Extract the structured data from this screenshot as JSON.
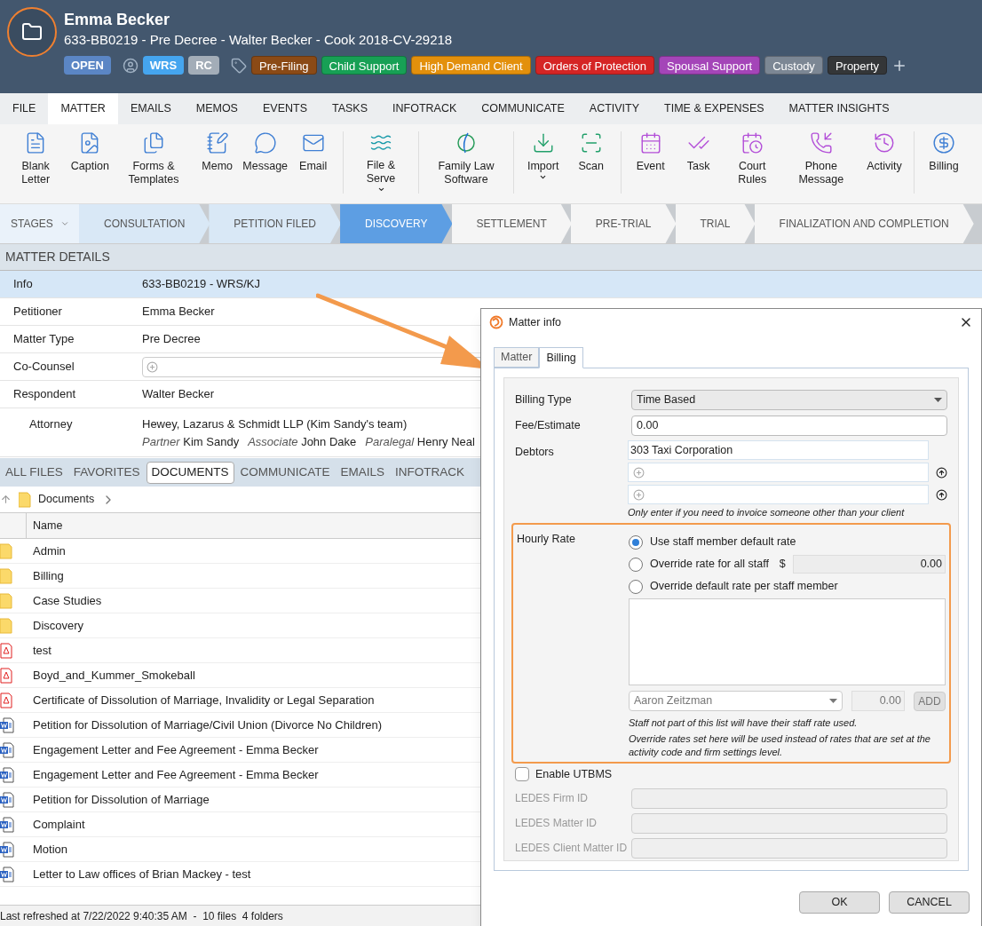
{
  "header": {
    "name": "Emma Becker",
    "subtitle": "633-BB0219 - Pre Decree - Walter Becker - Cook 2018-CV-29218",
    "status": "OPEN",
    "staff": [
      {
        "label": "WRS",
        "color": "#45a5ef"
      },
      {
        "label": "RC",
        "color": "#a3adb8"
      }
    ],
    "tags": [
      {
        "label": "Pre-Filing",
        "color": "#8b4a16"
      },
      {
        "label": "Child Support",
        "color": "#17a055"
      },
      {
        "label": "High Demand Client",
        "color": "#e3900c"
      },
      {
        "label": "Orders of Protection",
        "color": "#d52525"
      },
      {
        "label": "Spousal Support",
        "color": "#a445b8"
      },
      {
        "label": "Custody",
        "color": "#7c8794"
      },
      {
        "label": "Property",
        "color": "#343638"
      }
    ]
  },
  "ribbon_tabs": [
    {
      "label": "FILE",
      "selected": false
    },
    {
      "label": "MATTER",
      "selected": true
    },
    {
      "label": "EMAILS",
      "selected": false
    },
    {
      "label": "MEMOS",
      "selected": false
    },
    {
      "label": "EVENTS",
      "selected": false
    },
    {
      "label": "TASKS",
      "selected": false
    },
    {
      "label": "INFOTRACK",
      "selected": false
    },
    {
      "label": "COMMUNICATE",
      "selected": false
    },
    {
      "label": "ACTIVITY",
      "selected": false
    },
    {
      "label": "TIME & EXPENSES",
      "selected": false
    },
    {
      "label": "MATTER INSIGHTS",
      "selected": false
    }
  ],
  "toolbar_groups": [
    {
      "items": [
        {
          "label": "Blank Letter",
          "dropdown": false
        },
        {
          "label": "Caption",
          "dropdown": false
        },
        {
          "label": "Forms & Templates",
          "dropdown": false
        },
        {
          "label": "Memo",
          "dropdown": false
        },
        {
          "label": "Message",
          "dropdown": false
        },
        {
          "label": "Email",
          "dropdown": false
        }
      ]
    },
    {
      "items": [
        {
          "label": "File & Serve",
          "dropdown": true
        }
      ]
    },
    {
      "items": [
        {
          "label": "Family Law Software",
          "dropdown": false
        }
      ]
    },
    {
      "items": [
        {
          "label": "Import",
          "dropdown": true
        },
        {
          "label": "Scan",
          "dropdown": false
        }
      ]
    },
    {
      "items": [
        {
          "label": "Event",
          "dropdown": false
        },
        {
          "label": "Task",
          "dropdown": false
        },
        {
          "label": "Court Rules",
          "dropdown": false
        },
        {
          "label": "Phone Message",
          "dropdown": false
        },
        {
          "label": "Activity",
          "dropdown": false
        }
      ]
    },
    {
      "items": [
        {
          "label": "Billing",
          "dropdown": false
        }
      ]
    }
  ],
  "stages": {
    "label": "STAGES",
    "items": [
      {
        "label": "CONSULTATION",
        "completed": true,
        "selected": false
      },
      {
        "label": "PETITION FILED",
        "completed": true,
        "selected": false
      },
      {
        "label": "DISCOVERY",
        "completed": false,
        "selected": true
      },
      {
        "label": "SETTLEMENT",
        "completed": false,
        "selected": false
      },
      {
        "label": "PRE-TRIAL",
        "completed": false,
        "selected": false
      },
      {
        "label": "TRIAL",
        "completed": false,
        "selected": false
      },
      {
        "label": "FINALIZATION AND COMPLETION",
        "completed": false,
        "selected": false
      }
    ]
  },
  "matter_details": {
    "title": "MATTER DETAILS",
    "rows": [
      {
        "label": "Info",
        "value": "633-BB0219 - WRS/KJ",
        "selected": true
      },
      {
        "label": "Petitioner",
        "value": "Emma Becker",
        "selected": false
      },
      {
        "label": "Matter Type",
        "value": "Pre Decree",
        "selected": false
      },
      {
        "label": "Co-Counsel",
        "kind": "field",
        "selected": false
      },
      {
        "label": "Respondent",
        "value": "Walter Becker",
        "selected": false,
        "children": [
          {
            "label": "Attorney",
            "value": "Hewey, Lazarus & Schmidt LLP (Kim Sandy's team)",
            "team": [
              {
                "role": "Partner",
                "name": "Kim Sandy"
              },
              {
                "role": "Associate",
                "name": "John Dake"
              },
              {
                "role": "Paralegal",
                "name": "Henry Neal"
              }
            ]
          }
        ]
      }
    ]
  },
  "file_tabs": [
    {
      "label": "ALL FILES",
      "selected": false
    },
    {
      "label": "FAVORITES",
      "selected": false
    },
    {
      "label": "DOCUMENTS",
      "selected": true
    },
    {
      "label": "COMMUNICATE",
      "selected": false
    },
    {
      "label": "EMAILS",
      "selected": false
    },
    {
      "label": "INFOTRACK",
      "selected": false
    }
  ],
  "breadcrumb": "Documents",
  "files_table": {
    "columns": [
      "Name"
    ],
    "rows": [
      {
        "name": "Admin",
        "kind": "folder"
      },
      {
        "name": "Billing",
        "kind": "folder"
      },
      {
        "name": "Case Studies",
        "kind": "folder"
      },
      {
        "name": "Discovery",
        "kind": "folder"
      },
      {
        "name": "test",
        "kind": "pdf"
      },
      {
        "name": "Boyd_and_Kummer_Smokeball",
        "kind": "pdf"
      },
      {
        "name": "Certificate of Dissolution of Marriage, Invalidity or Legal Separation",
        "kind": "pdf"
      },
      {
        "name": "Petition for Dissolution of Marriage/Civil Union (Divorce No Children)",
        "kind": "word"
      },
      {
        "name": "Engagement Letter and Fee Agreement - Emma Becker",
        "kind": "word"
      },
      {
        "name": "Engagement Letter and Fee Agreement - Emma Becker",
        "kind": "word"
      },
      {
        "name": "Petition for Dissolution of Marriage",
        "kind": "word"
      },
      {
        "name": "Complaint",
        "kind": "word"
      },
      {
        "name": "Motion",
        "kind": "word"
      },
      {
        "name": "Letter to Law offices of Brian Mackey - test",
        "kind": "word"
      }
    ]
  },
  "status_bar": "Last refreshed at 7/22/2022 9:40:35 AM  -  10 files  4 folders",
  "dialog": {
    "title": "Matter info",
    "tabs": [
      {
        "label": "Matter",
        "selected": false
      },
      {
        "label": "Billing",
        "selected": true
      }
    ],
    "billing_type": {
      "label": "Billing Type",
      "value": "Time Based"
    },
    "fee_estimate": {
      "label": "Fee/Estimate",
      "value": "0.00"
    },
    "debtors": {
      "label": "Debtors",
      "value": "303 Taxi Corporation",
      "hint": "Only enter if you need to invoice someone other than your client"
    },
    "hourly_rate": {
      "label": "Hourly Rate",
      "options": [
        {
          "label": "Use staff member default rate",
          "selected": true
        },
        {
          "label": "Override rate for all staff",
          "selected": false,
          "currency": "$",
          "value": "0.00"
        },
        {
          "label": "Override default rate per staff member",
          "selected": false
        }
      ],
      "staff": "Aaron Zeitzman",
      "rate": "0.00",
      "add": "ADD",
      "notes": [
        "Staff not part of this list will have their staff rate used.",
        "Override rates set here will be used instead of rates that are set at the activity code and firm settings level."
      ]
    },
    "utbms": {
      "label": "Enable UTBMS",
      "checked": false
    },
    "ledes": [
      {
        "label": "LEDES Firm ID",
        "disabled": true
      },
      {
        "label": "LEDES Matter ID",
        "disabled": true
      },
      {
        "label": "LEDES Client Matter ID",
        "disabled": true
      }
    ],
    "buttons": [
      "OK",
      "CANCEL"
    ]
  }
}
